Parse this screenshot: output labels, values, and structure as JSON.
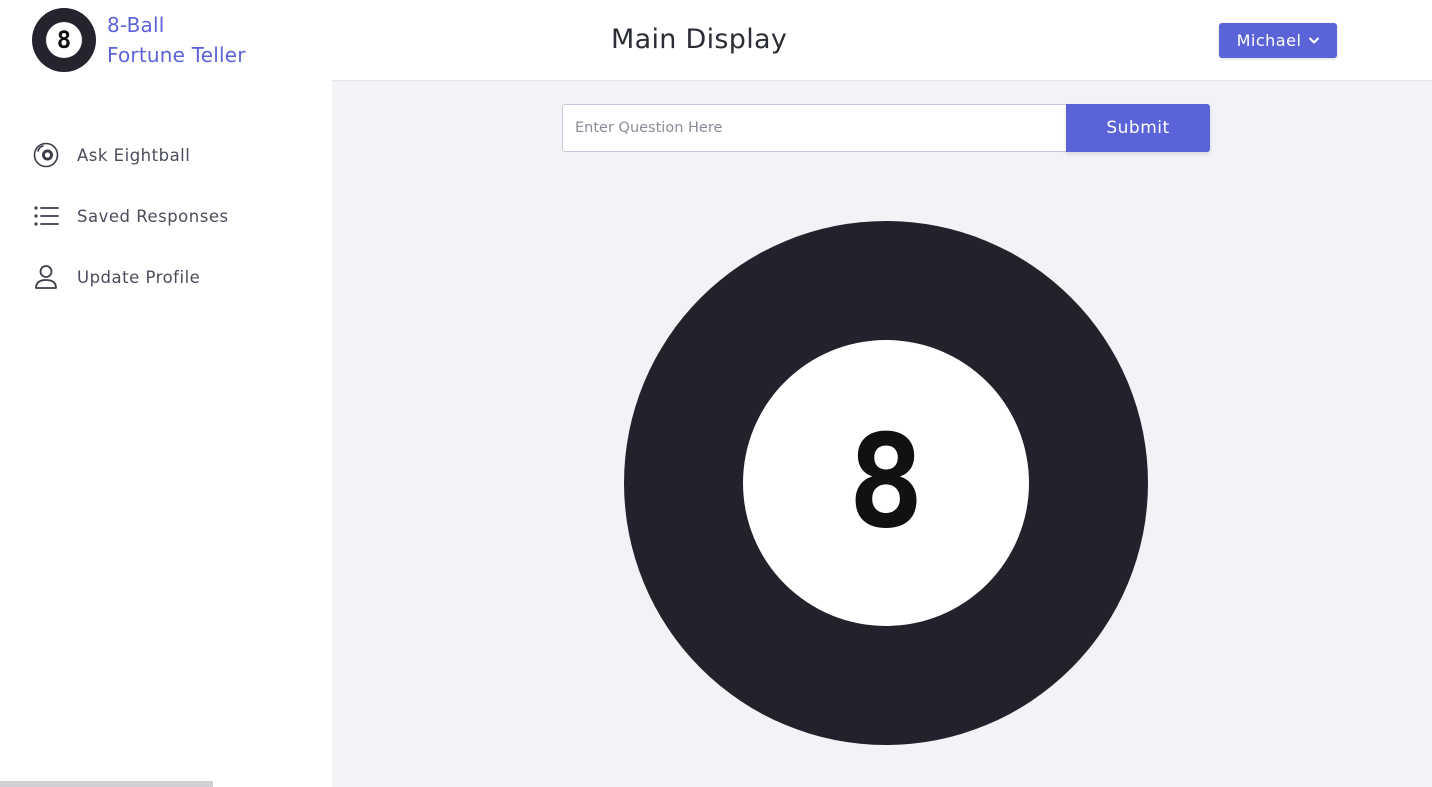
{
  "brand": {
    "logo_glyph": "8",
    "line1": "8-Ball",
    "line2": "Fortune Teller",
    "color": "#5b63d9"
  },
  "sidebar": {
    "items": [
      {
        "label": "Ask Eightball",
        "icon": "eightball-icon"
      },
      {
        "label": "Saved Responses",
        "icon": "list-icon"
      },
      {
        "label": "Update Profile",
        "icon": "user-icon"
      }
    ]
  },
  "header": {
    "title": "Main Display",
    "user_menu_label": "Michael",
    "user_menu_icon": "chevron-down-icon"
  },
  "question": {
    "value": "",
    "placeholder": "Enter Question Here",
    "submit_label": "Submit"
  },
  "eightball": {
    "number": "8"
  },
  "colors": {
    "accent": "#5b63d9",
    "ball": "#22222d",
    "main_bg": "#f2f3f7"
  }
}
